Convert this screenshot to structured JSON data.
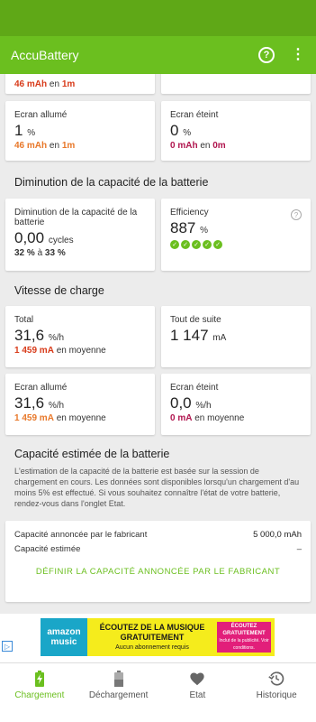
{
  "app": {
    "title": "AccuBattery"
  },
  "colors": {
    "accent": "#6bbf1f",
    "orange": "#e8782a",
    "red": "#d83b1a",
    "magenta": "#b0154e"
  },
  "top_partial": {
    "value": "46 mAh",
    "connector": "en",
    "time": "1m"
  },
  "screen_on_discharge": {
    "label": "Ecran allumé",
    "value": "1",
    "unit": "%",
    "mah": "46 mAh",
    "connector": "en",
    "time": "1m"
  },
  "screen_off_discharge": {
    "label": "Ecran éteint",
    "value": "0",
    "unit": "%",
    "mah": "0 mAh",
    "connector": "en",
    "time": "0m"
  },
  "capacity_section": {
    "title": "Diminution de la capacité de la batterie"
  },
  "capacity_card": {
    "label": "Diminution de la capacité de la batterie",
    "value": "0,00",
    "unit": "cycles",
    "range_from": "32 %",
    "range_connector": "à",
    "range_to": "33 %"
  },
  "efficiency_card": {
    "label": "Efficiency",
    "value": "887",
    "unit": "%",
    "rating": 5
  },
  "speed_section": {
    "title": "Vitesse de charge"
  },
  "total_card": {
    "label": "Total",
    "value": "31,6",
    "unit": "%/h",
    "ma": "1 459 mA",
    "suffix": "en moyenne"
  },
  "now_card": {
    "label": "Tout de suite",
    "value": "1 147",
    "unit": "mA"
  },
  "screen_on_speed": {
    "label": "Ecran allumé",
    "value": "31,6",
    "unit": "%/h",
    "ma": "1 459 mA",
    "suffix": "en moyenne"
  },
  "screen_off_speed": {
    "label": "Ecran éteint",
    "value": "0,0",
    "unit": "%/h",
    "ma": "0 mA",
    "suffix": "en moyenne"
  },
  "estimate_section": {
    "title": "Capacité estimée de la batterie",
    "description": "L'estimation de la capacité de la batterie est basée sur la session de chargement en cours. Les données sont disponibles lorsqu'un chargement d'au moins 5% est effectué. Si vous souhaitez connaître l'état de votre batterie, rendez-vous dans l'onglet Etat."
  },
  "estimate_card": {
    "rated_label": "Capacité annoncée par le fabricant",
    "rated_value": "5 000,0 mAh",
    "estimated_label": "Capacité estimée",
    "estimated_value": "–",
    "action_label": "DÉFINIR LA CAPACITÉ ANNONCÉE PAR LE FABRICANT"
  },
  "ad": {
    "logo": "amazon music",
    "headline": "ÉCOUTEZ DE LA MUSIQUE GRATUITEMENT",
    "sub": "Aucun abonnement requis",
    "badge": "ÉCOUTEZ GRATUITEMENT",
    "badge_sub": "Inclut de la publicité. Voir conditions."
  },
  "nav": [
    {
      "label": "Chargement",
      "icon": "battery-charging-icon",
      "active": true
    },
    {
      "label": "Déchargement",
      "icon": "battery-icon",
      "active": false
    },
    {
      "label": "Etat",
      "icon": "heart-icon",
      "active": false
    },
    {
      "label": "Historique",
      "icon": "history-icon",
      "active": false
    }
  ]
}
